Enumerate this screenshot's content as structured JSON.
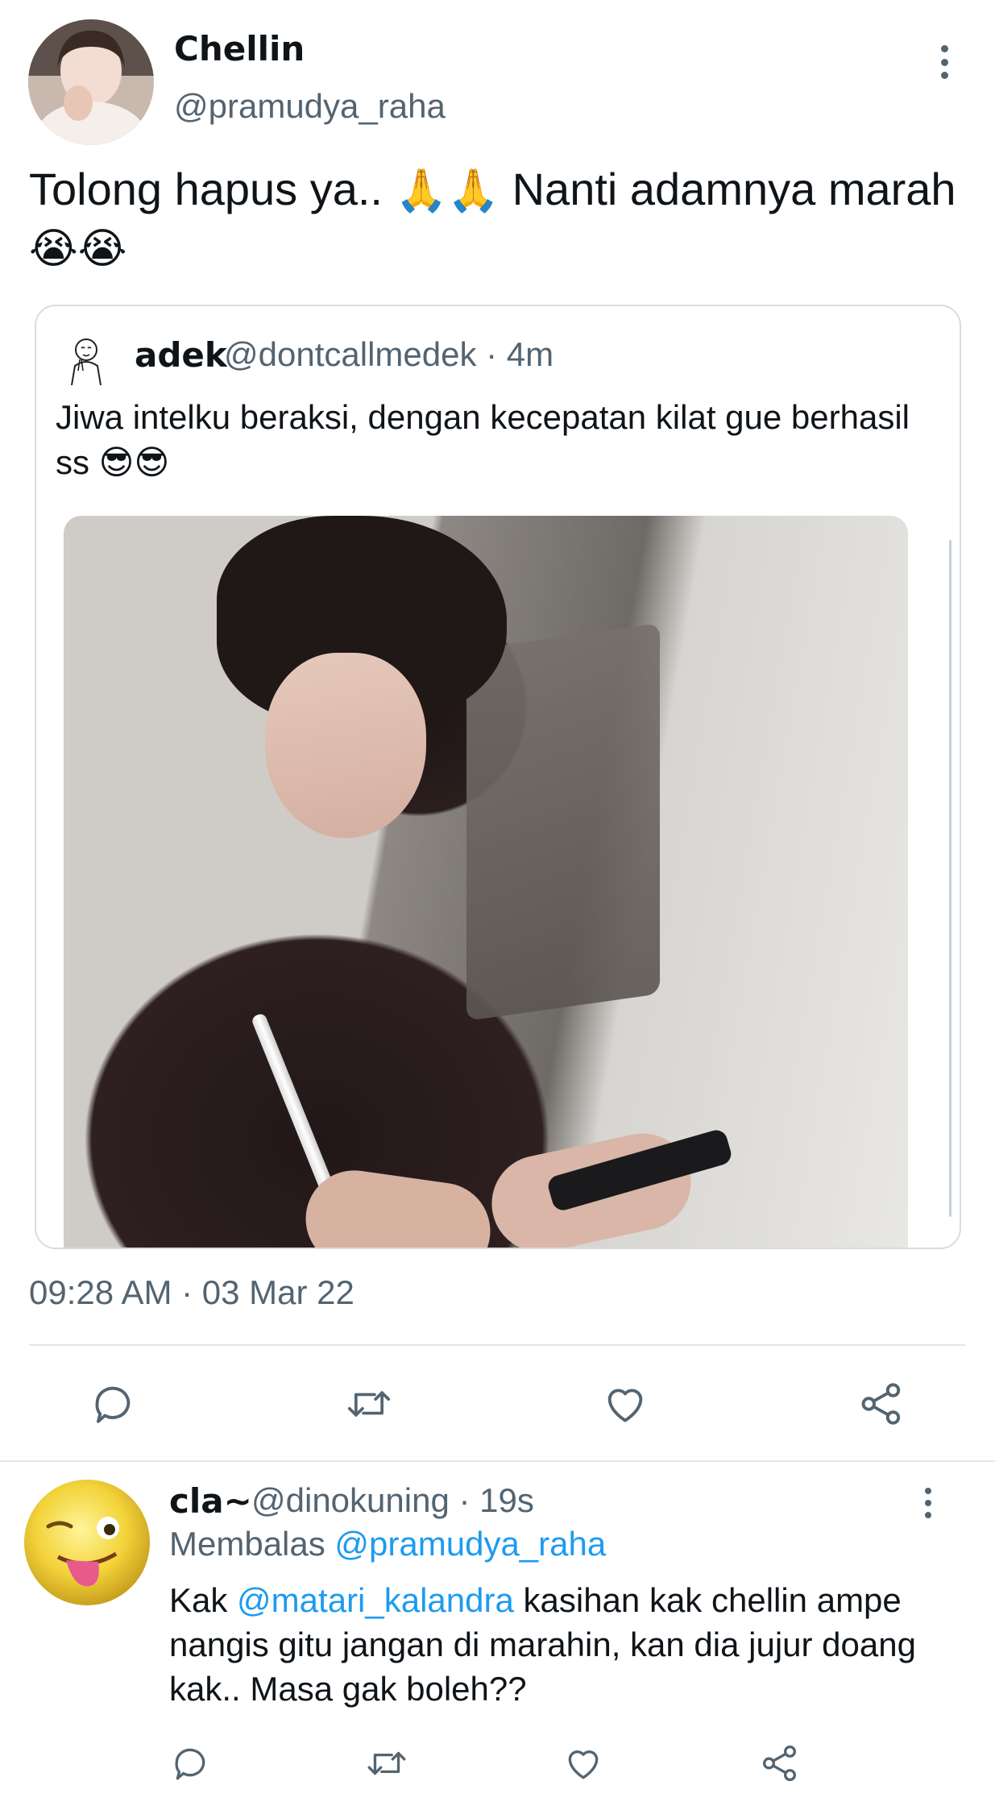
{
  "main_tweet": {
    "display_name": "Chellin",
    "handle": "@pramudya_raha",
    "text_part1": "Tolong hapus ya.. ",
    "emoji_pray": "🙏🙏",
    "text_part2": " Nanti adamnya marah",
    "emoji_cry": "😭😭",
    "timestamp": "09:28 AM · 03 Mar 22"
  },
  "quoted_tweet": {
    "display_name": "adek",
    "meta": "@dontcallmedek · 4m",
    "text": "Jiwa intelku beraksi, dengan kecepatan kilat gue berhasil ss ",
    "emoji": "😎😎"
  },
  "reply": {
    "display_name": "cla~",
    "meta": "@dinokuning · 19s",
    "replying_prefix": "Membalas ",
    "replying_to": "@pramudya_raha",
    "text_prefix": "Kak ",
    "mention": "@matari_kalandra",
    "text_rest": " kasihan kak chellin ampe nangis gitu jangan di marahin, kan dia jujur doang kak.. Masa gak boleh??"
  },
  "icons": {
    "reply": "reply-icon",
    "retweet": "retweet-icon",
    "like": "like-icon",
    "share": "share-icon",
    "more": "more-vertical-icon"
  },
  "colors": {
    "text": "#0f1419",
    "secondary": "#536471",
    "link": "#1d9bf0",
    "border": "#d6dde1"
  }
}
